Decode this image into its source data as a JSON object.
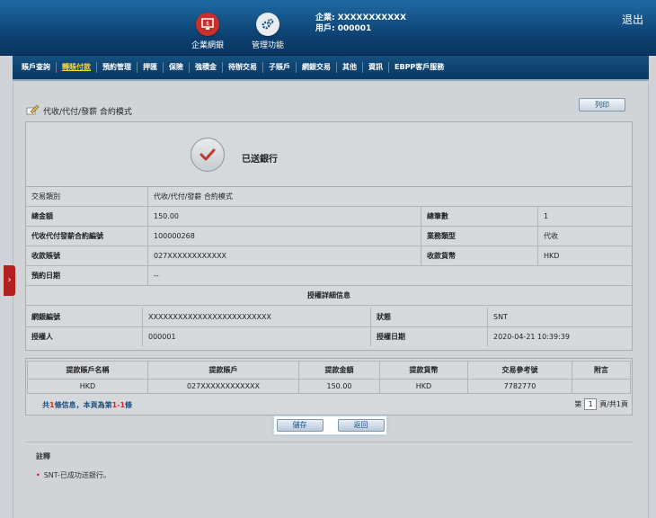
{
  "header": {
    "corp_portal_label": "企業網銀",
    "admin_label": "管理功能",
    "enterprise_line": "企業: XXXXXXXXXXX",
    "user_line": "用戶: 000001",
    "logout_label": "退出"
  },
  "nav": [
    "賬戶查詢",
    "轉賬付款",
    "預約管理",
    "押匯",
    "保險",
    "強積金",
    "待辦交易",
    "子賬戶",
    "網銀交易",
    "其他",
    "資訊",
    "EBPP客戶服務"
  ],
  "page": {
    "title": "代收/代付/發薪 合約模式",
    "print_label": "列印",
    "status_text": "已送銀行"
  },
  "details": {
    "trans_type_label": "交易類別",
    "trans_type_value": "代收/代付/發薪 合約模式",
    "total_label": "總金額",
    "total_value": "150.00",
    "count_label": "總筆數",
    "count_value": "1",
    "contract_label": "代收代付發薪合約編號",
    "contract_value": "100000268",
    "biz_label": "業務類型",
    "biz_value": "代收",
    "acct_label": "收款賬號",
    "acct_value": "027XXXXXXXXXXXX",
    "ccy_label": "收款貨幣",
    "ccy_value": "HKD",
    "booking_label": "預約日期",
    "booking_value": "--",
    "auth_header": "授權詳細信息",
    "ref_label": "網銀編號",
    "ref_value": "XXXXXXXXXXXXXXXXXXXXXXXXX",
    "state_label": "狀態",
    "state_value": "SNT",
    "authorizer_label": "授權人",
    "authorizer_value": "000001",
    "auth_date_label": "授權日期",
    "auth_date_value": "2020-04-21 10:39:39"
  },
  "table": {
    "headers": [
      "提款賬戶名稱",
      "提款賬戶",
      "提款金額",
      "提款貨幣",
      "交易參考號",
      "附言"
    ],
    "rows": [
      [
        "HKD",
        "027XXXXXXXXXXXX",
        "150.00",
        "HKD",
        "7782770",
        ""
      ]
    ]
  },
  "pagination": {
    "summary_pre": "共",
    "total_records": "1",
    "summary_mid": "條信息，本頁為第",
    "range": "1-1",
    "summary_post": "條",
    "page_prefix": "第",
    "current_page": "1",
    "page_suffix": "頁/共1頁"
  },
  "actions": {
    "save_label": "儲存",
    "back_label": "返回"
  },
  "notes": {
    "title": "註釋",
    "item": "SNT-已成功送銀行。"
  },
  "colors": {
    "header_bg": "#0c3f6f",
    "active_nav": "#ffd633",
    "check_red": "#c0392b"
  }
}
